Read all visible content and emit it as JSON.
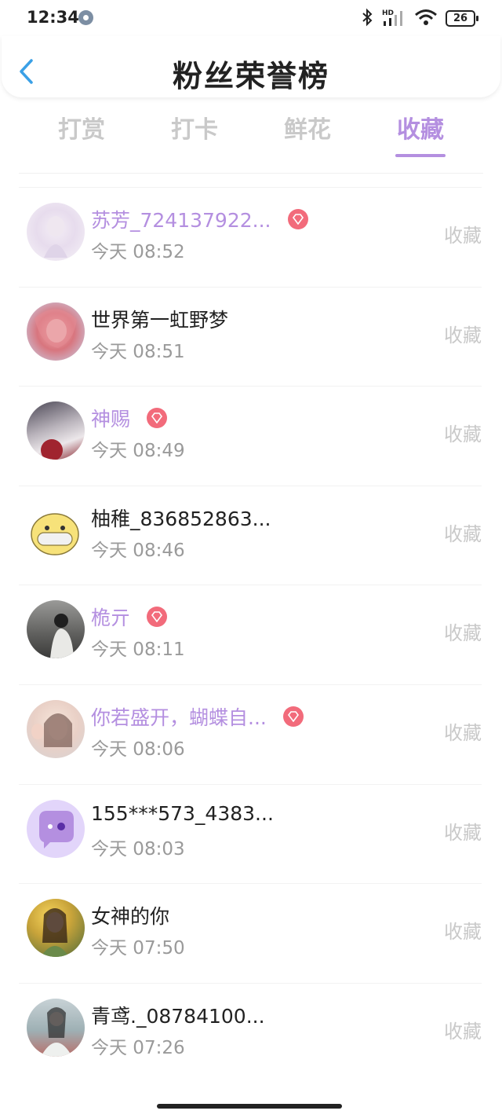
{
  "status_bar": {
    "time": "12:34",
    "battery": "26",
    "signal_label": "HD"
  },
  "header": {
    "title": "粉丝荣誉榜"
  },
  "tabs": [
    {
      "label": "打赏",
      "active": false
    },
    {
      "label": "打卡",
      "active": false
    },
    {
      "label": "鲜花",
      "active": false
    },
    {
      "label": "收藏",
      "active": true
    }
  ],
  "colors": {
    "accent": "#b48fe0",
    "badge": "#f26b7b",
    "muted": "#c9c9c9"
  },
  "rows": [
    {
      "name": "苏芳_724137922...",
      "vip": true,
      "time": "今天 08:52",
      "action": "收藏"
    },
    {
      "name": "世界第一虹野梦",
      "vip": false,
      "time": "今天 08:51",
      "action": "收藏"
    },
    {
      "name": "神赐",
      "vip": true,
      "time": "今天 08:49",
      "action": "收藏"
    },
    {
      "name": "柚稚_836852863...",
      "vip": false,
      "time": "今天 08:46",
      "action": "收藏"
    },
    {
      "name": "桅亓",
      "vip": true,
      "time": "今天 08:11",
      "action": "收藏"
    },
    {
      "name": "你若盛开，蝴蝶自...",
      "vip": true,
      "time": "今天 08:06",
      "action": "收藏"
    },
    {
      "name": "155***573_4383...",
      "vip": false,
      "time": "今天 08:03",
      "action": "收藏"
    },
    {
      "name": "女神的你",
      "vip": false,
      "time": "今天 07:50",
      "action": "收藏"
    },
    {
      "name": "青鸢._08784100...",
      "vip": false,
      "time": "今天 07:26",
      "action": "收藏"
    }
  ]
}
